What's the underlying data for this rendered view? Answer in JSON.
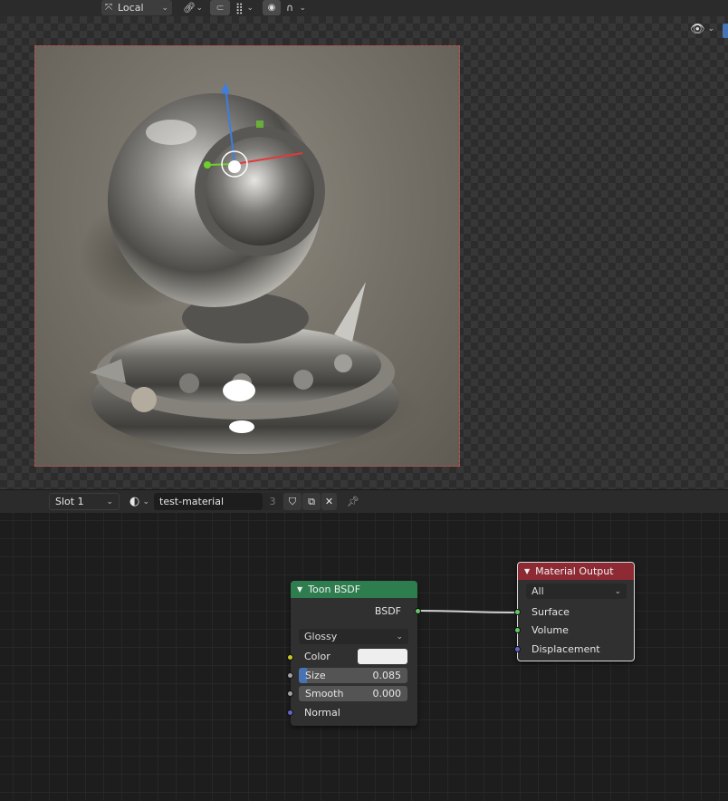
{
  "viewport_header": {
    "transform_orientation": "Local",
    "visibility_icon": "eye-icon"
  },
  "material_header": {
    "slot": "Slot 1",
    "material_name": "test-material",
    "user_count": "3"
  },
  "toon_node": {
    "title": "Toon BSDF",
    "output_label": "BSDF",
    "component": "Glossy",
    "color_label": "Color",
    "color_value": "#eeeeee",
    "size_label": "Size",
    "size_value": "0.085",
    "smooth_label": "Smooth",
    "smooth_value": "0.000",
    "normal_label": "Normal"
  },
  "output_node": {
    "title": "Material Output",
    "target": "All",
    "surface_label": "Surface",
    "volume_label": "Volume",
    "displacement_label": "Displacement"
  },
  "colors": {
    "toon_header": "#2e7d4f",
    "output_header": "#8d2a33",
    "shader_socket": "#63c763",
    "color_socket": "#c7c729",
    "float_socket": "#a1a1a1",
    "vector_socket": "#6363c7"
  }
}
